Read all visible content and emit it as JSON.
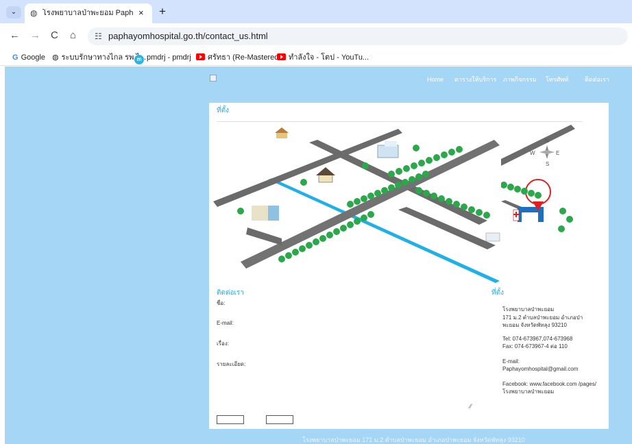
{
  "browser": {
    "tab_menu_icon": "chevron-down-icon",
    "tab_title": "โรงพยาบาลป่าพะยอม PaphayomH",
    "tab_close": "×",
    "new_tab": "+",
    "back": "←",
    "forward": "→",
    "reload": "C",
    "home": "⌂",
    "url": "paphayomhospital.go.th/contact_us.html"
  },
  "bookmarks": [
    {
      "label": "Google"
    },
    {
      "label": "ระบบรักษาทางไกล รพ.ไ..."
    },
    {
      "label": "pmdrj - pmdrj"
    },
    {
      "label": "ศรัทธา (Re-Mastered..."
    },
    {
      "label": "ทำลังใจ - โตป - YouTu..."
    }
  ],
  "nav": {
    "home": "Home",
    "schedule": "ตารางให้บริการ",
    "activities": "ภาพกิจกรรม",
    "phone": "โทรศัพท์",
    "contact": "ติดต่อเรา"
  },
  "location_title": "ที่ตั้ง",
  "contact_title": "ติดต่อเรา",
  "form": {
    "name_label": "ชื่อ:",
    "email_label": "E-mail:",
    "subject_label": "เรื่อง:",
    "detail_label": "รายละเอียด:"
  },
  "info": {
    "title": "ที่ตั้ง",
    "name": "โรงพยาบาลป่าพะยอม",
    "address": "171 ม.2 ตำบลป่าพะยอม อำเภอป่าพะยอม จังหวัดพัทลุง 93210",
    "tel": "Tel: 074-673967,074-673968",
    "fax": "Fax: 074-673967-4 ต่อ 110",
    "email_label": "E-mail:",
    "email": "Paphayomhospital@gmail.com",
    "facebook": "Facebook: www.facebook.com /pages/โรงพยาบาลป่าพะยอม"
  },
  "footer": "โรงพยาบาลป่าพะยอม 171 ม.2 ตำบลป่าพะยอม อำเภอป่าพะยอม จังหวัดพัทลุง 93210",
  "map": {
    "compass": {
      "n": "N",
      "s": "S",
      "e": "E",
      "w": "W"
    }
  },
  "colors": {
    "page_bg": "#a6d6f5",
    "accent": "#29abe2",
    "road": "#6b6b6b",
    "river": "#1fb0e8",
    "tree": "#2aa84a"
  }
}
